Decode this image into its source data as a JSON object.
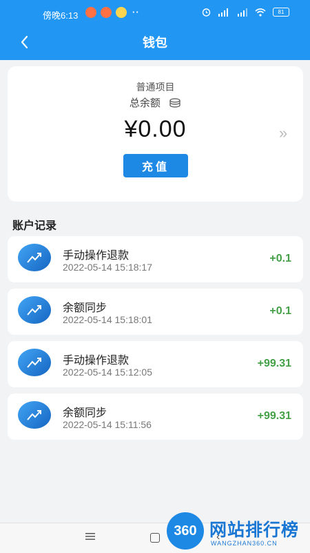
{
  "status_bar": {
    "time": "傍晚6:13",
    "dots": "··",
    "battery": "81"
  },
  "header": {
    "title": "钱包"
  },
  "wallet": {
    "project": "普通项目",
    "balance_label": "总余额",
    "amount": "¥0.00",
    "recharge_label": "充值",
    "more_arrow": "»"
  },
  "records_section": {
    "title": "账户记录"
  },
  "records": [
    {
      "name": "手动操作退款",
      "date": "2022-05-14 15:18:17",
      "amount": "+0.1"
    },
    {
      "name": "余额同步",
      "date": "2022-05-14 15:18:01",
      "amount": "+0.1"
    },
    {
      "name": "手动操作退款",
      "date": "2022-05-14 15:12:05",
      "amount": "+99.31"
    },
    {
      "name": "余额同步",
      "date": "2022-05-14 15:11:56",
      "amount": "+99.31"
    }
  ],
  "watermark": {
    "badge": "360",
    "cn": "网站排行榜",
    "en": "WANGZHAN360.CN"
  },
  "colors": {
    "primary": "#2196f3",
    "button": "#1e88e5",
    "positive": "#43a047",
    "background": "#f2f3f5"
  },
  "icons": [
    "back-arrow-icon",
    "coins-icon",
    "trend-up-icon",
    "menu-icon",
    "home-icon",
    "back-icon"
  ]
}
